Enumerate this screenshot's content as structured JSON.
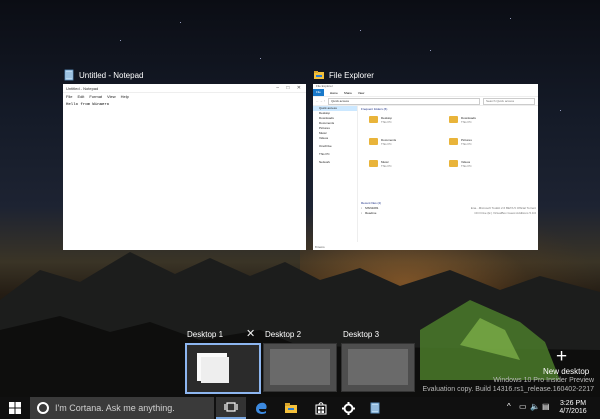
{
  "windows": [
    {
      "id": "notepad",
      "title": "Untitled - Notepad",
      "thumb_title": "Untitled - Notepad",
      "menu": [
        "File",
        "Edit",
        "Format",
        "View",
        "Help"
      ],
      "content": "Hello from Winaero"
    },
    {
      "id": "explorer",
      "title": "File Explorer",
      "thumb_title": "File Explorer",
      "ribbon": [
        "File",
        "Home",
        "Share",
        "View"
      ],
      "address": "Quick access",
      "search_placeholder": "Search Quick access",
      "nav": [
        "Quick access",
        "Desktop",
        "Downloads",
        "Documents",
        "Pictures",
        "Music",
        "Videos",
        "OneDrive",
        "This PC",
        "Network"
      ],
      "frequent_header": "Frequent folders (6)",
      "folders": [
        {
          "name": "Desktop",
          "loc": "This PC"
        },
        {
          "name": "Downloads",
          "loc": "This PC"
        },
        {
          "name": "Documents",
          "loc": "This PC"
        },
        {
          "name": "Pictures",
          "loc": "This PC"
        },
        {
          "name": "Music",
          "loc": "This PC"
        },
        {
          "name": "Videos",
          "loc": "This PC"
        }
      ],
      "recent_header": "Recent files (2)",
      "recent": [
        {
          "name": "MSN1081",
          "path": "Ena...Microsoft Toolkit 2.6 BETA 5 Official Torrent"
        },
        {
          "name": "Readme",
          "path": "CD Drive (E:) VirtualBox Guest Additions 5.0.0"
        }
      ],
      "status": "8 items"
    }
  ],
  "desktops": [
    {
      "label": "Desktop 1",
      "active": true
    },
    {
      "label": "Desktop 2",
      "active": false
    },
    {
      "label": "Desktop 3",
      "active": false
    }
  ],
  "close_glyph": "✕",
  "new_desktop": {
    "plus": "+",
    "label": "New desktop"
  },
  "watermark": {
    "line1": "Windows 10 Pro Insider Preview",
    "line2": "Evaluation copy. Build 14316.rs1_release.160402-2217"
  },
  "taskbar": {
    "search_placeholder": "I'm Cortana. Ask me anything.",
    "icons": [
      "windows-logo-icon",
      "task-view-icon",
      "edge-icon",
      "file-explorer-icon",
      "store-icon",
      "settings-icon",
      "notepad-icon"
    ],
    "tray": {
      "chevron": "^",
      "network": "▭",
      "volume": "🔈",
      "notification": "▤"
    },
    "time": "3:26 PM",
    "date": "4/7/2016"
  },
  "colors": {
    "accent": "#1979ca",
    "active_border": "#8db6f0",
    "taskbar": "#101010",
    "folder": "#e9b43a"
  }
}
